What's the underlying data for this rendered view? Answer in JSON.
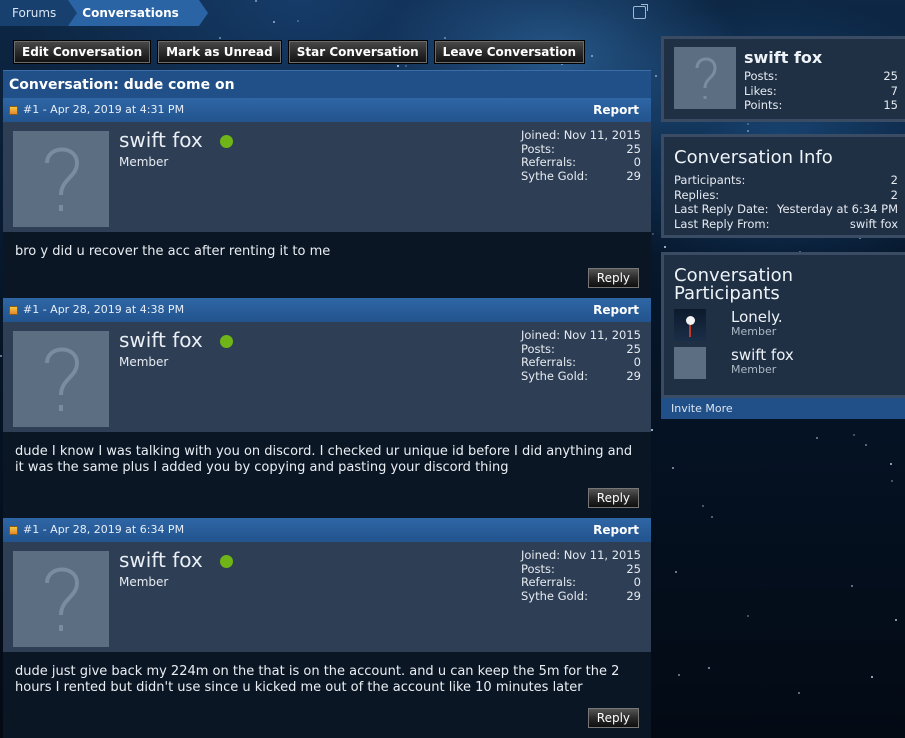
{
  "breadcrumb": [
    "Forums",
    "Conversations"
  ],
  "actions": [
    "Edit Conversation",
    "Mark as Unread",
    "Star Conversation",
    "Leave Conversation"
  ],
  "conversation_title": "Conversation: dude come on",
  "messages": [
    {
      "meta": "#1 - Apr 28, 2019 at 4:31 PM",
      "report": "Report",
      "user": "swift fox",
      "role": "Member",
      "stats": [
        [
          "Joined:",
          "Nov 11, 2015"
        ],
        [
          "Posts:",
          "25"
        ],
        [
          "Referrals:",
          "0"
        ],
        [
          "Sythe Gold:",
          "29"
        ]
      ],
      "text": "bro y did u recover the acc after renting it to me",
      "reply": "Reply"
    },
    {
      "meta": "#1 - Apr 28, 2019 at 4:38 PM",
      "report": "Report",
      "user": "swift fox",
      "role": "Member",
      "stats": [
        [
          "Joined:",
          "Nov 11, 2015"
        ],
        [
          "Posts:",
          "25"
        ],
        [
          "Referrals:",
          "0"
        ],
        [
          "Sythe Gold:",
          "29"
        ]
      ],
      "text": "dude I know I was talking with you on discord. I checked ur unique id before I did anything and it was the same plus I added you by copying and pasting your discord thing",
      "reply": "Reply"
    },
    {
      "meta": "#1 - Apr 28, 2019 at 6:34 PM",
      "report": "Report",
      "user": "swift fox",
      "role": "Member",
      "stats": [
        [
          "Joined:",
          "Nov 11, 2015"
        ],
        [
          "Posts:",
          "25"
        ],
        [
          "Referrals:",
          "0"
        ],
        [
          "Sythe Gold:",
          "29"
        ]
      ],
      "text": "dude just give back my 224m on the that is on the account. and u can keep the 5m for the 2 hours I rented but didn't use since u kicked me out of the account like 10 minutes later",
      "reply": "Reply"
    }
  ],
  "sidebar": {
    "profile": {
      "name": "swift fox",
      "stats": [
        [
          "Posts:",
          "25"
        ],
        [
          "Likes:",
          "7"
        ],
        [
          "Points:",
          "15"
        ]
      ]
    },
    "info": {
      "title": "Conversation Info",
      "rows": [
        [
          "Participants:",
          "2"
        ],
        [
          "Replies:",
          "2"
        ],
        [
          "Last Reply Date:",
          "Yesterday at 6:34 PM"
        ],
        [
          "Last Reply From:",
          "swift fox"
        ]
      ]
    },
    "participants": {
      "title": "Conversation Participants",
      "list": [
        {
          "name": "Lonely.",
          "role": "Member"
        },
        {
          "name": "swift fox",
          "role": "Member"
        }
      ]
    },
    "invite": "Invite More"
  },
  "colors": {
    "online": "#6fb518",
    "header_blue": "#214f87"
  }
}
